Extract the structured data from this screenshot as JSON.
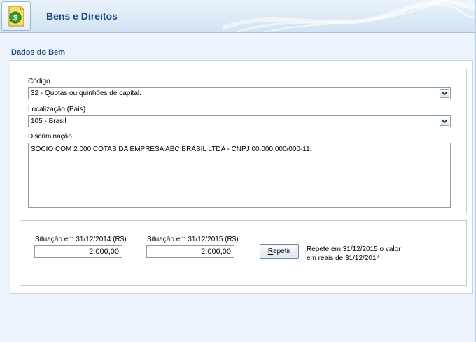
{
  "header": {
    "title": "Bens e Direitos",
    "icon": "dollar-document-icon"
  },
  "section": {
    "title": "Dados do Bem"
  },
  "codigo": {
    "label": "Código",
    "value": "32 - Quotas ou quinhões de capital."
  },
  "localizacao": {
    "label": "Localização (País)",
    "value": "105 - Brasil"
  },
  "discriminacao": {
    "label": "Discriminação",
    "value": "SÓCIO COM 2.000 COTAS DA EMPRESA ABC BRASIL LTDA - CNPJ 00.000.000/000-11."
  },
  "situacao_2014": {
    "label": "Situação em 31/12/2014 (R$)",
    "value": "2.000,00"
  },
  "situacao_2015": {
    "label": "Situação em 31/12/2015 (R$)",
    "value": "2.000,00"
  },
  "repetir": {
    "mnemonic": "R",
    "rest": "epetir"
  },
  "note": {
    "line1": "Repete em 31/12/2015 o valor",
    "line2": "em reais de 31/12/2014"
  },
  "colors": {
    "accent": "#1c4a7e",
    "background": "#edf3fa",
    "icon_green": "#3a9a2a",
    "icon_yellow": "#f2d24a"
  }
}
